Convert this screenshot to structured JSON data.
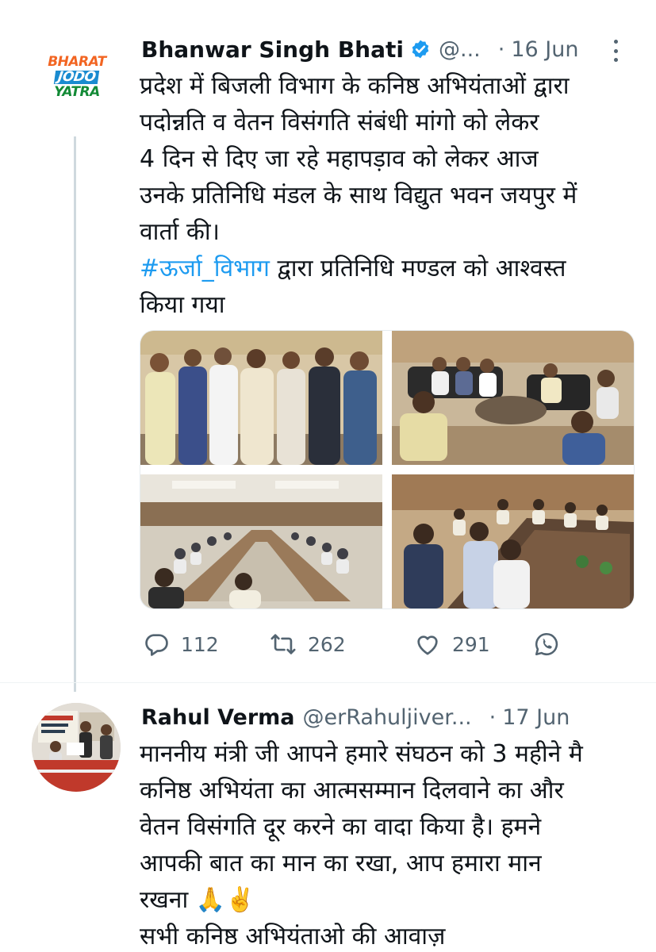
{
  "tweet1": {
    "avatar_logo_lines": [
      "BHARAT",
      "JODO",
      "YATRA"
    ],
    "name": "Bhanwar Singh Bhati",
    "handle": "@...",
    "separator": "·",
    "time": "16 Jun",
    "lines": [
      "प्रदेश में बिजली विभाग के कनिष्ठ अभियंताओं द्वारा",
      "पदोन्नति व वेतन विसंगति संबंधी मांगो को लेकर",
      "4 दिन से दिए जा रहे महापड़ाव को लेकर आज",
      "उनके प्रतिनिधि मंडल के साथ विद्युत भवन जयपुर में",
      "वार्ता की।"
    ],
    "hashtag": "#ऊर्जा_विभाग",
    "hashtag_rest": " द्वारा प्रतिनिधि मण्डल को आश्वस्त",
    "last_line": "किया गया",
    "actions": {
      "replies": "112",
      "retweets": "262",
      "likes": "291"
    }
  },
  "tweet2": {
    "name": "Rahul Verma",
    "handle": "@erRahuljiver...",
    "separator": "·",
    "time": "17 Jun",
    "lines": [
      "माननीय मंत्री जी आपने हमारे संघठन को 3 महीने मै",
      "कनिष्ठ अभियंता का आत्मसम्मान दिलवाने का और",
      "वेतन विसंगति दूर करने का वादा किया है। हमने",
      "आपकी बात का मान का रखा, आप हमारा मान",
      "रखना"
    ],
    "emojis": "🙏✌️",
    "last_line": "सभी कनिष्ठ अभियंताओ की आवाज़"
  },
  "colors": {
    "link": "#1d9bf0",
    "secondary_text": "#536471",
    "thread_line": "#cfd9de"
  },
  "icons": [
    "verified-badge-icon",
    "more-options-icon",
    "reply-icon",
    "retweet-icon",
    "like-icon",
    "whatsapp-share-icon"
  ]
}
